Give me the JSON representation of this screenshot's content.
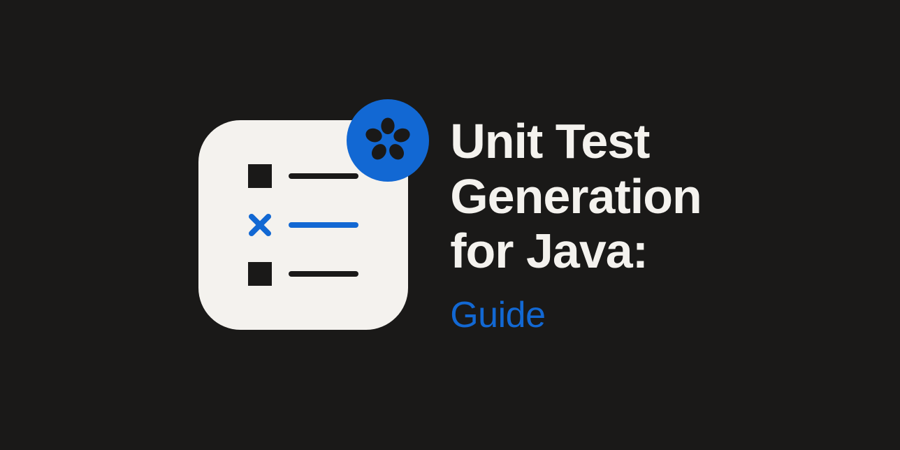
{
  "title": {
    "line1": "Unit Test",
    "line2": "Generation",
    "line3": "for Java:"
  },
  "subtitle": "Guide",
  "colors": {
    "background": "#1a1918",
    "card": "#f4f2ee",
    "accent": "#1268d3",
    "text": "#f4f2ee"
  },
  "icons": {
    "badge": "flower-logo-icon",
    "checklist_rows": [
      {
        "marker": "square",
        "state": "default"
      },
      {
        "marker": "x",
        "state": "failed"
      },
      {
        "marker": "square",
        "state": "default"
      }
    ]
  }
}
